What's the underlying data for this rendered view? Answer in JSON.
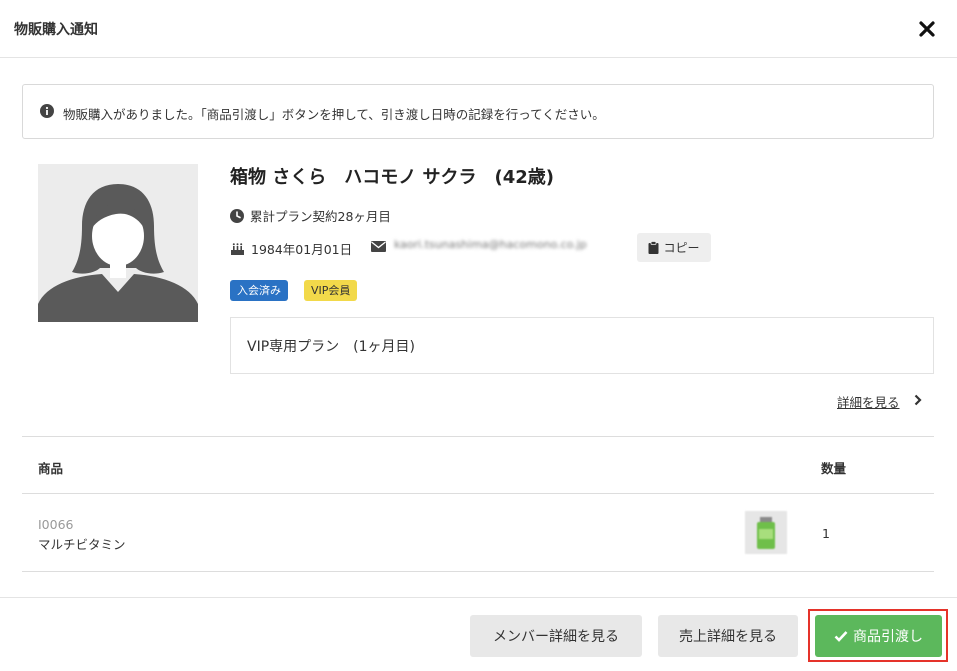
{
  "modal": {
    "title": "物販購入通知"
  },
  "notice": {
    "text": "物販購入がありました。「商品引渡し」ボタンを押して、引き渡し日時の記録を行ってください。"
  },
  "member": {
    "name": "箱物 さくら　ハコモノ サクラ　(42歳)",
    "contract": "累計プラン契約28ヶ月目",
    "birthday": "1984年01月01日",
    "email": "kaori.tsunashima@hacomono.co.jp",
    "copy_label": "コピー",
    "badges": {
      "status": "入会済み",
      "tier": "VIP会員"
    },
    "plan": "VIP専用プラン　(1ヶ月目)",
    "detail_link": "詳細を見る"
  },
  "table": {
    "headers": {
      "product": "商品",
      "quantity": "数量"
    },
    "rows": [
      {
        "code": "I0066",
        "name": "マルチビタミン",
        "quantity": "1"
      }
    ]
  },
  "footer": {
    "member_detail": "メンバー詳細を見る",
    "sales_detail": "売上詳細を見る",
    "deliver": "商品引渡し"
  },
  "colors": {
    "badge_status": "#2a72c4",
    "badge_tier": "#f2d94a",
    "deliver_button": "#5cb85c",
    "highlight_frame": "#e5332a"
  },
  "icons": {
    "close": "close-icon",
    "info": "info-icon",
    "clock": "clock-icon",
    "cake": "cake-icon",
    "mail": "mail-icon",
    "clipboard": "clipboard-icon",
    "chevron": "chevron-right-icon",
    "check": "check-icon"
  }
}
